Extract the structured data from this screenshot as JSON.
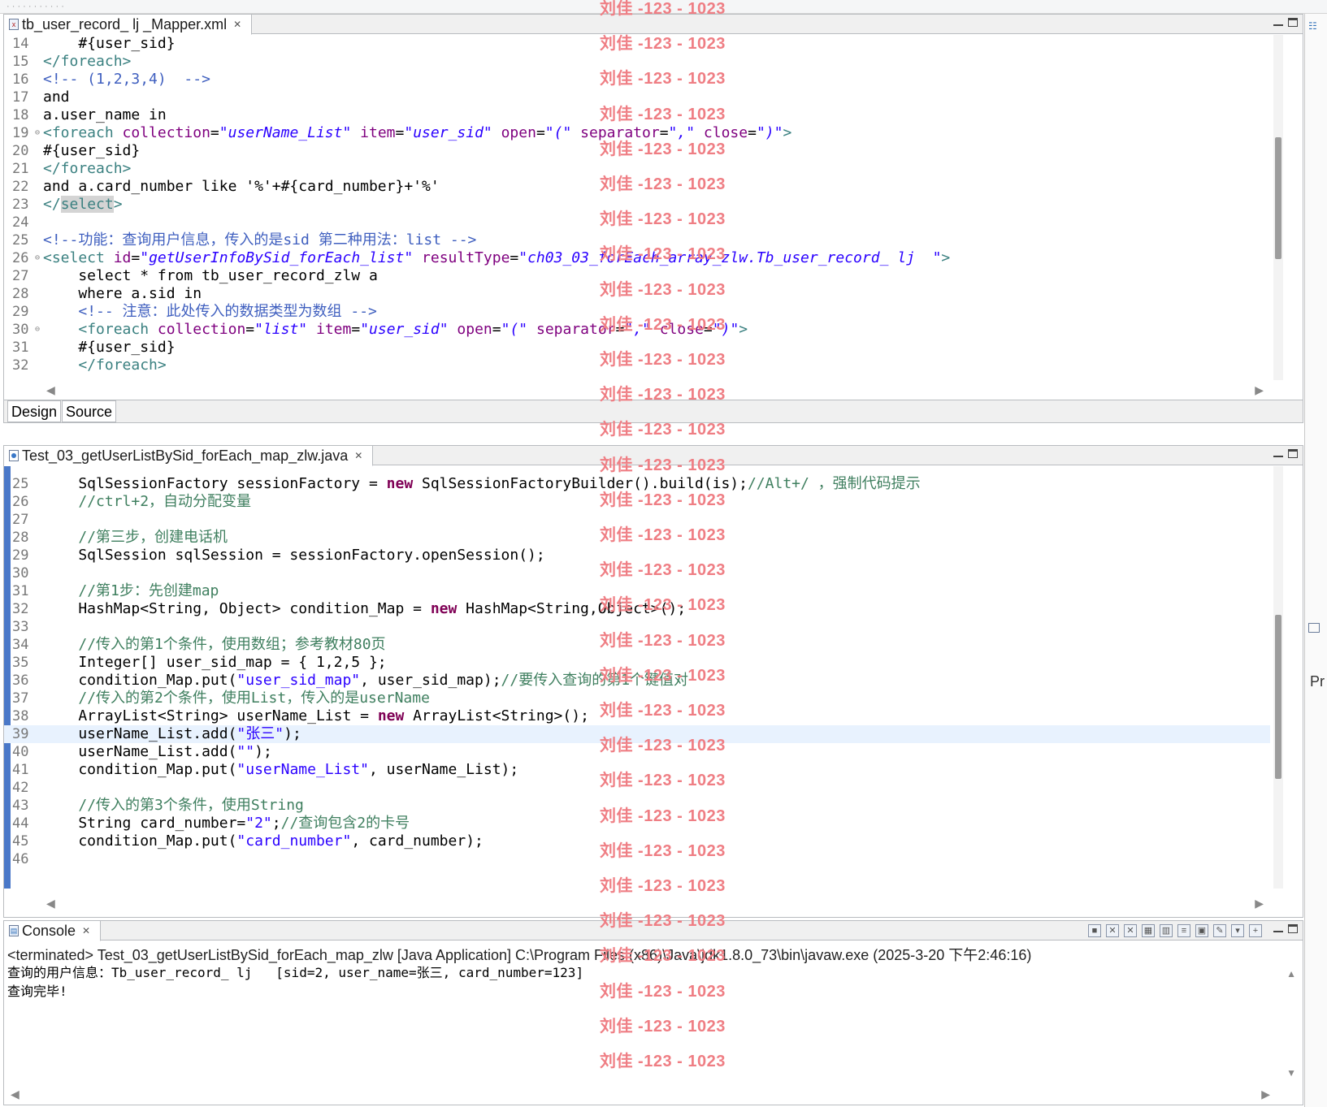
{
  "editor1": {
    "tab_title": "tb_user_record_  lj _Mapper.xml",
    "lines": [
      {
        "n": "14",
        "html": "    #{user_sid}"
      },
      {
        "n": "15",
        "html": "<span class=\"tag\">&lt;/foreach&gt;</span>"
      },
      {
        "n": "16",
        "html": "<span class=\"cm\">&lt;!-- (1,2,3,4)  --&gt;</span>"
      },
      {
        "n": "17",
        "html": "and"
      },
      {
        "n": "18",
        "html": "a.user_name in"
      },
      {
        "n": "19",
        "fold": true,
        "html": "<span class=\"tag\">&lt;foreach</span> <span class=\"attr\">collection</span>=<span class=\"val\">\"userName_List\"</span> <span class=\"attr\">item</span>=<span class=\"val\">\"user_sid\"</span> <span class=\"attr\">open</span>=<span class=\"val\">\"(\"</span> <span class=\"attr\">separator</span>=<span class=\"val\">\",\"</span> <span class=\"attr\">close</span>=<span class=\"val\">\")\"</span><span class=\"tag\">&gt;</span>"
      },
      {
        "n": "20",
        "html": "#{user_sid}"
      },
      {
        "n": "21",
        "html": "<span class=\"tag\">&lt;/foreach&gt;</span>"
      },
      {
        "n": "22",
        "html": "and a.card_number like '%'+#{card_number}+'%'"
      },
      {
        "n": "23",
        "html": "<span class=\"tag\">&lt;/<span class=\"sel\">select</span>&gt;</span>"
      },
      {
        "n": "24",
        "html": ""
      },
      {
        "n": "25",
        "html": "<span class=\"cm\">&lt;!--功能：查询用户信息，传入的是sid 第二种用法：list --&gt;</span>"
      },
      {
        "n": "26",
        "fold": true,
        "html": "<span class=\"tag\">&lt;select</span> <span class=\"attr\">id</span>=<span class=\"val\">\"getUserInfoBySid_forEach_list\"</span> <span class=\"attr\">resultType</span>=<span class=\"val\">\"ch03_03_forEach_array_zlw.Tb_user_record_ lj  \"</span><span class=\"tag\">&gt;</span>"
      },
      {
        "n": "27",
        "html": "    select * from tb_user_record_zlw a"
      },
      {
        "n": "28",
        "html": "    where a.sid in"
      },
      {
        "n": "29",
        "html": "    <span class=\"cm\">&lt;!-- 注意：此处传入的数据类型为数组 --&gt;</span>"
      },
      {
        "n": "30",
        "fold": true,
        "html": "    <span class=\"tag\">&lt;foreach</span> <span class=\"attr\">collection</span>=<span class=\"val\">\"list\"</span> <span class=\"attr\">item</span>=<span class=\"val\">\"user_sid\"</span> <span class=\"attr\">open</span>=<span class=\"val\">\"(\"</span> <span class=\"attr\">separator</span>=<span class=\"val\">\",\"</span> <span class=\"attr\">close</span>=<span class=\"val\">\")\"</span><span class=\"tag\">&gt;</span>"
      },
      {
        "n": "31",
        "html": "    #{user_sid}"
      },
      {
        "n": "32",
        "html": "    <span class=\"tag\">&lt;/foreach&gt;</span>"
      }
    ],
    "design_tab": "Design",
    "source_tab": "Source"
  },
  "editor2": {
    "tab_title": "Test_03_getUserListBySid_forEach_map_zlw.java",
    "lines": [
      {
        "n": "25",
        "html": "    SqlSessionFactory sessionFactory = <span class=\"kw\">new</span> SqlSessionFactoryBuilder().build(is);<span class=\"jc\">//Alt+/ ，强制代码提示</span>"
      },
      {
        "n": "26",
        "html": "    <span class=\"jc\">//ctrl+2，自动分配变量</span>"
      },
      {
        "n": "27",
        "html": ""
      },
      {
        "n": "28",
        "html": "    <span class=\"jc\">//第三步，创建电话机</span>"
      },
      {
        "n": "29",
        "html": "    SqlSession sqlSession = sessionFactory.openSession();"
      },
      {
        "n": "30",
        "html": ""
      },
      {
        "n": "31",
        "html": "    <span class=\"jc\">//第1步：先创建map</span>"
      },
      {
        "n": "32",
        "html": "    HashMap&lt;String, Object&gt; condition_Map = <span class=\"kw\">new</span> HashMap&lt;String,Object&gt;();"
      },
      {
        "n": "33",
        "html": ""
      },
      {
        "n": "34",
        "html": "    <span class=\"jc\">//传入的第1个条件，使用数组；参考教材80页</span>"
      },
      {
        "n": "35",
        "html": "    Integer[] user_sid_map = { 1,2,5 };"
      },
      {
        "n": "36",
        "html": "    condition_Map.put(<span class=\"str\">\"user_sid_map\"</span>, user_sid_map);<span class=\"jc\">//要传入查询的第1个键值对</span>"
      },
      {
        "n": "37",
        "html": "    <span class=\"jc\">//传入的第2个条件，使用List，传入的是userName</span>"
      },
      {
        "n": "38",
        "html": "    ArrayList&lt;String&gt; userName_List = <span class=\"kw\">new</span> ArrayList&lt;String&gt;();"
      },
      {
        "n": "39",
        "current": true,
        "html": "    userName_List.add(<span class=\"str\">\"张三\"</span>);"
      },
      {
        "n": "40",
        "html": "    userName_List.add(<span class=\"str\">\"\"</span>);"
      },
      {
        "n": "41",
        "html": "    condition_Map.put(<span class=\"str\">\"userName_List\"</span>, userName_List);"
      },
      {
        "n": "42",
        "html": ""
      },
      {
        "n": "43",
        "html": "    <span class=\"jc\">//传入的第3个条件，使用String</span>"
      },
      {
        "n": "44",
        "html": "    String card_number=<span class=\"str\">\"2\"</span>;<span class=\"jc\">//查询包含2的卡号</span>"
      },
      {
        "n": "45",
        "html": "    condition_Map.put(<span class=\"str\">\"card_number\"</span>, card_number);"
      },
      {
        "n": "46",
        "html": ""
      }
    ]
  },
  "console": {
    "tab_title": "Console",
    "info": "<terminated> Test_03_getUserListBySid_forEach_map_zlw [Java Application] C:\\Program Files (x86)\\Java\\jdk1.8.0_73\\bin\\javaw.exe (2025-3-20 下午2:46:16)",
    "output": [
      "查询的用户信息：Tb_user_record_ lj   [sid=2, user_name=张三, card_number=123]",
      "查询完毕!"
    ]
  },
  "right_panel": {
    "label": "Pr"
  },
  "watermark": {
    "text": "刘佳 -123 - 1023",
    "color": "#ef7e84",
    "count": 31
  },
  "icons": [
    "xml-file-icon",
    "java-file-icon",
    "console-icon",
    "close-icon",
    "minimize-icon",
    "maximize-icon",
    "scroll-left-icon",
    "scroll-right-icon",
    "scroll-up-icon",
    "scroll-down-icon"
  ]
}
